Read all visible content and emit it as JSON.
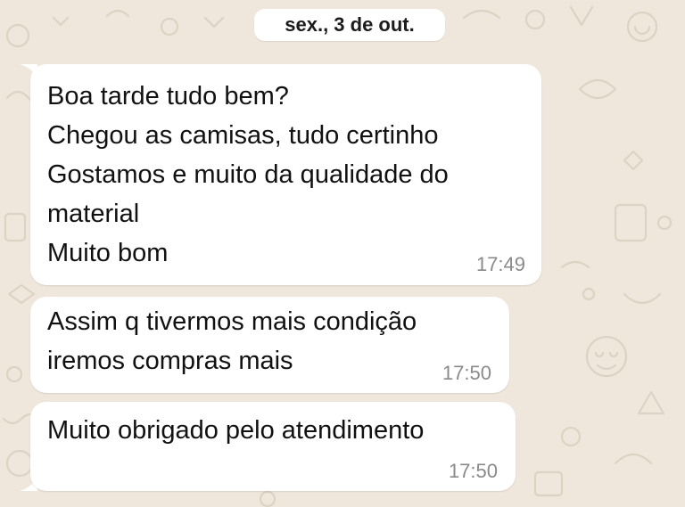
{
  "chat": {
    "date_separator": "sex., 3 de out.",
    "messages": [
      {
        "lines": [
          "Boa tarde tudo bem?",
          "Chegou as camisas, tudo certinho",
          "Gostamos e muito da qualidade do",
          "material",
          "Muito bom"
        ],
        "time": "17:49"
      },
      {
        "lines": [
          "Assim q tivermos mais condição",
          "iremos compras mais"
        ],
        "time": "17:50"
      },
      {
        "lines": [
          "Muito obrigado pelo atendimento"
        ],
        "time": "17:50"
      }
    ]
  },
  "colors": {
    "wallpaper": "#efe7dc",
    "doodles": "#ddd3c4",
    "bubble": "#ffffff",
    "text": "#111111",
    "timestamp": "#8a8a8a"
  }
}
